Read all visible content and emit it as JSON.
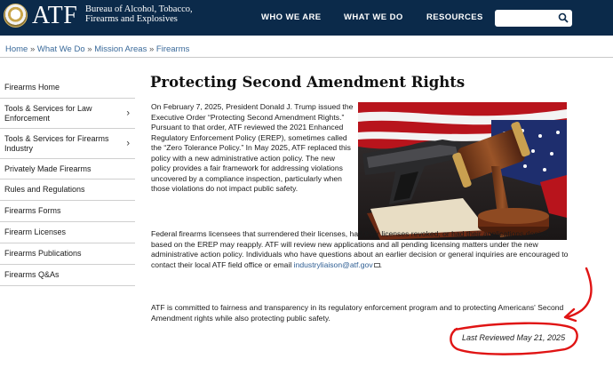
{
  "header": {
    "logo": "ATF",
    "bureau_line1": "Bureau of Alcohol, Tobacco,",
    "bureau_line2": "Firearms and Explosives",
    "nav": [
      "WHO WE ARE",
      "WHAT WE DO",
      "RESOURCES"
    ],
    "search_placeholder": ""
  },
  "breadcrumb": {
    "items": [
      "Home",
      "What We Do",
      "Mission Areas",
      "Firearms"
    ],
    "separator": "»"
  },
  "sidebar": {
    "items": [
      {
        "label": "Firearms Home",
        "expandable": false
      },
      {
        "label": "Tools & Services for Law Enforcement",
        "expandable": true
      },
      {
        "label": "Tools & Services for Firearms Industry",
        "expandable": true
      },
      {
        "label": "Privately Made Firearms",
        "expandable": false
      },
      {
        "label": "Rules and Regulations",
        "expandable": false
      },
      {
        "label": "Firearms Forms",
        "expandable": false
      },
      {
        "label": "Firearm Licenses",
        "expandable": false
      },
      {
        "label": "Firearms Publications",
        "expandable": false
      },
      {
        "label": "Firearms Q&As",
        "expandable": false
      }
    ]
  },
  "main": {
    "title": "Protecting Second Amendment Rights",
    "p1": "On February 7, 2025, President Donald J. Trump issued the Executive Order “Protecting Second Amendment Rights.”  Pursuant to that order, ATF reviewed the 2021 Enhanced Regulatory Enforcement Policy (EREP), sometimes called the “Zero Tolerance Policy.”  In May 2025, ATF replaced this policy with a new administrative action policy. The new policy provides a fair framework for addressing violations uncovered by a compliance inspection, particularly when those violations do not impact public safety.",
    "p2_text": "Federal firearms licensees that surrendered their licenses, had their licenses revoked, or had their applications denied based on the EREP may reapply.  ATF will review new applications and all pending licensing matters under the new administrative action policy.  Individuals who have questions about an earlier decision or general inquiries are encouraged to contact their local ATF field office or email ",
    "p2_email": "industryliaison@atf.gov",
    "p2_end": ".",
    "p3": "ATF is committed to fairness and transparency in its regulatory enforcement program and to protecting Americans' Second Amendment rights while also protecting public safety.",
    "last_reviewed": "Last Reviewed May 21, 2025"
  },
  "colors": {
    "header_bg": "#0b2a4a",
    "link": "#2e5e93",
    "annotation": "#e01414"
  }
}
